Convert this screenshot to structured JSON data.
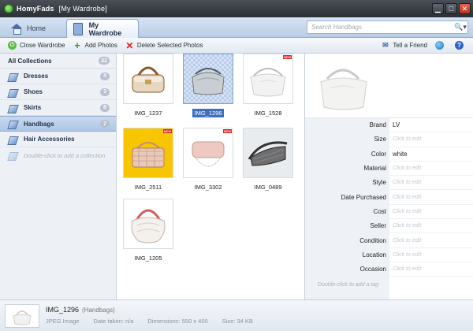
{
  "window": {
    "app_name": "HomyFads",
    "doc_title": "[My Wardrobe]"
  },
  "nav": {
    "home_label": "Home",
    "wardrobe_label": "My Wardrobe",
    "search_placeholder": "Search Handbags"
  },
  "toolbar": {
    "close_label": "Close Wardrobe",
    "add_label": "Add Photos",
    "delete_label": "Delete Selected Photos",
    "tell_label": "Tell a Friend"
  },
  "sidebar": {
    "all_label": "All Collections",
    "all_count": "22",
    "items": [
      {
        "label": "Dresses",
        "count": "4"
      },
      {
        "label": "Shoes",
        "count": "3"
      },
      {
        "label": "Skirts",
        "count": "8"
      },
      {
        "label": "Handbags",
        "count": "7"
      },
      {
        "label": "Hair Accessories",
        "count": ""
      }
    ],
    "add_hint": "Double-click to add a collection"
  },
  "grid": {
    "items": [
      {
        "caption": "IMG_1237",
        "new_badge": ""
      },
      {
        "caption": "IMG_1296",
        "new_badge": ""
      },
      {
        "caption": "IMG_1528",
        "new_badge": "NEW"
      },
      {
        "caption": "IMG_2511",
        "new_badge": "NEW"
      },
      {
        "caption": "IMG_3302",
        "new_badge": "NEW"
      },
      {
        "caption": "IMG_0489",
        "new_badge": ""
      },
      {
        "caption": "IMG_1205",
        "new_badge": ""
      }
    ]
  },
  "details": {
    "properties": [
      {
        "name": "Brand",
        "value": "LV"
      },
      {
        "name": "Size",
        "value": "Click to edit"
      },
      {
        "name": "Color",
        "value": "white"
      },
      {
        "name": "Material",
        "value": "Click to edit"
      },
      {
        "name": "Style",
        "value": "Click to edit"
      },
      {
        "name": "Date Purchased",
        "value": "Click to edit"
      },
      {
        "name": "Cost",
        "value": "Click to edit"
      },
      {
        "name": "Seller",
        "value": "Click to edit"
      },
      {
        "name": "Condition",
        "value": "Click to edit"
      },
      {
        "name": "Location",
        "value": "Click to edit"
      },
      {
        "name": "Occasion",
        "value": "Click to edit"
      }
    ],
    "add_tag_hint": "Double-click to add a tag"
  },
  "status": {
    "filename": "IMG_1296",
    "collection": "(Handbags)",
    "type": "JPEG Image",
    "date_taken": "Date taken: n/a",
    "dimensions": "Dimensions: 550 x 400",
    "size": "Size: 34 KB"
  },
  "colors": {
    "accent": "#3f6fbf",
    "selected_row": "#b9cee9",
    "titlebar": "#2b2f35"
  }
}
